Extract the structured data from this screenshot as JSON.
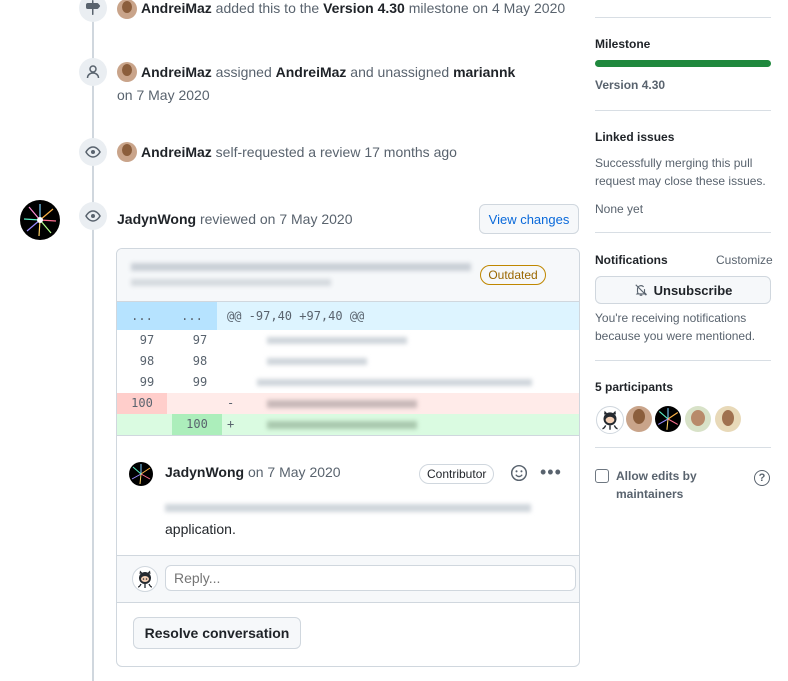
{
  "timeline": {
    "event1": {
      "actor": "AndreiMaz",
      "text1": " added this to the ",
      "milestone": "Version 4.30",
      "text2": " milestone on 4 May 2020"
    },
    "event2": {
      "actor": "AndreiMaz",
      "text1": " assigned ",
      "assignee": "AndreiMaz",
      "text2": " and unassigned ",
      "unassigned": "mariannk",
      "date": "on 7 May 2020"
    },
    "event3": {
      "actor": "AndreiMaz",
      "text": " self-requested a review 17 months ago"
    },
    "review": {
      "actor": "JadynWong",
      "text": " reviewed on 7 May 2020",
      "view_changes": "View changes"
    }
  },
  "review_box": {
    "outdated": "Outdated",
    "hunk": {
      "old": "...",
      "new": "...",
      "header": "@@ -97,40 +97,40 @@"
    },
    "lines": [
      {
        "old": "97",
        "new": "97",
        "sign": ""
      },
      {
        "old": "98",
        "new": "98",
        "sign": ""
      },
      {
        "old": "99",
        "new": "99",
        "sign": ""
      },
      {
        "old": "100",
        "new": "",
        "sign": "-"
      },
      {
        "old": "",
        "new": "100",
        "sign": "+"
      }
    ],
    "comment": {
      "author": "JadynWong",
      "date": "on 7 May 2020",
      "role": "Contributor",
      "body_end": "application."
    },
    "reply_placeholder": "Reply...",
    "resolve": "Resolve conversation"
  },
  "sidebar": {
    "milestone_header": "Milestone",
    "milestone_name": "Version 4.30",
    "milestone_progress": 1.0,
    "linked_header": "Linked issues",
    "linked_text": "Successfully merging this pull request may close these issues.",
    "linked_none": "None yet",
    "notifications_header": "Notifications",
    "customize": "Customize",
    "unsubscribe": "Unsubscribe",
    "notif_text": "You're receiving notifications because you were mentioned.",
    "participants_header": "5 participants",
    "allow_edits": "Allow edits by maintainers",
    "help": "?"
  },
  "colors": {
    "accent": "#0969da",
    "milestone_bar": "#1f883d",
    "outdated": "#9a6700",
    "diff_del": "#ffebe9",
    "diff_add": "#dafbe1",
    "hunk": "#ddf4ff"
  }
}
